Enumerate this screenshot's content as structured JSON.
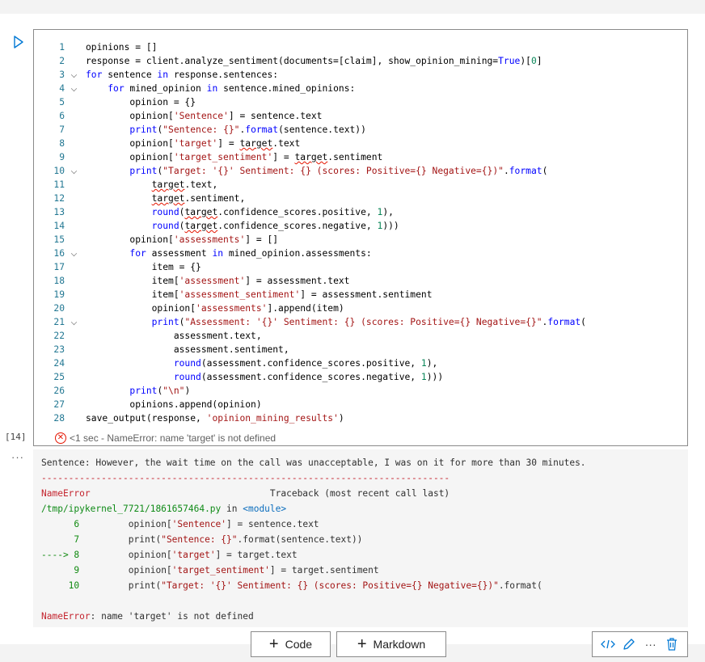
{
  "execution_count": "[14]",
  "status": {
    "text": "<1 sec - NameError: name 'target' is not defined"
  },
  "output_dots": "···",
  "code_lines": [
    {
      "n": "1",
      "fold": false,
      "html": "opinions = []"
    },
    {
      "n": "2",
      "fold": false,
      "html": "response = client.analyze_sentiment(documents=[claim], show_opinion_mining=<span class='k'>True</span>)[<span class='n'>0</span>]"
    },
    {
      "n": "3",
      "fold": true,
      "html": "<span class='k'>for</span> sentence <span class='k'>in</span> response.sentences:"
    },
    {
      "n": "4",
      "fold": true,
      "html": "    <span class='k'>for</span> mined_opinion <span class='k'>in</span> sentence.mined_opinions:"
    },
    {
      "n": "5",
      "fold": false,
      "html": "        opinion = {}"
    },
    {
      "n": "6",
      "fold": false,
      "html": "        opinion[<span class='s'>'Sentence'</span>] = sentence.text"
    },
    {
      "n": "7",
      "fold": false,
      "html": "        <span class='k'>print</span>(<span class='s'>\"Sentence: {}\"</span>.<span class='k'>format</span>(sentence.text))"
    },
    {
      "n": "8",
      "fold": false,
      "html": "        opinion[<span class='s'>'target'</span>] = <span class='err-u'>target</span>.text"
    },
    {
      "n": "9",
      "fold": false,
      "html": "        opinion[<span class='s'>'target_sentiment'</span>] = <span class='err-u'>target</span>.sentiment"
    },
    {
      "n": "10",
      "fold": true,
      "html": "        <span class='k'>print</span>(<span class='s'>\"Target: '{}' Sentiment: {} (scores: Positive={} Negative={})\"</span>.<span class='k'>format</span>("
    },
    {
      "n": "11",
      "fold": false,
      "html": "            <span class='err-u'>target</span>.text,"
    },
    {
      "n": "12",
      "fold": false,
      "html": "            <span class='err-u'>target</span>.sentiment,"
    },
    {
      "n": "13",
      "fold": false,
      "html": "            <span class='k'>round</span>(<span class='err-u'>target</span>.confidence_scores.positive, <span class='n'>1</span>),"
    },
    {
      "n": "14",
      "fold": false,
      "html": "            <span class='k'>round</span>(<span class='err-u'>target</span>.confidence_scores.negative, <span class='n'>1</span>)))"
    },
    {
      "n": "15",
      "fold": false,
      "html": "        opinion[<span class='s'>'assessments'</span>] = []"
    },
    {
      "n": "16",
      "fold": true,
      "html": "        <span class='k'>for</span> assessment <span class='k'>in</span> mined_opinion.assessments:"
    },
    {
      "n": "17",
      "fold": false,
      "html": "            item = {}"
    },
    {
      "n": "18",
      "fold": false,
      "html": "            item[<span class='s'>'assessment'</span>] = assessment.text"
    },
    {
      "n": "19",
      "fold": false,
      "html": "            item[<span class='s'>'assessment_sentiment'</span>] = assessment.sentiment"
    },
    {
      "n": "20",
      "fold": false,
      "html": "            opinion[<span class='s'>'assessments'</span>].append(item)"
    },
    {
      "n": "21",
      "fold": true,
      "html": "            <span class='k'>print</span>(<span class='s'>\"Assessment: '{}' Sentiment: {} (scores: Positive={} Negative={}\"</span>.<span class='k'>format</span>("
    },
    {
      "n": "22",
      "fold": false,
      "html": "                assessment.text,"
    },
    {
      "n": "23",
      "fold": false,
      "html": "                assessment.sentiment,"
    },
    {
      "n": "24",
      "fold": false,
      "html": "                <span class='k'>round</span>(assessment.confidence_scores.positive, <span class='n'>1</span>),"
    },
    {
      "n": "25",
      "fold": false,
      "html": "                <span class='k'>round</span>(assessment.confidence_scores.negative, <span class='n'>1</span>)))"
    },
    {
      "n": "26",
      "fold": false,
      "html": "        <span class='k'>print</span>(<span class='s'>\"\\n\"</span>)"
    },
    {
      "n": "27",
      "fold": false,
      "html": "        opinions.append(opinion)"
    },
    {
      "n": "28",
      "fold": false,
      "html": "save_output(response, <span class='s'>'opinion_mining_results'</span>)"
    }
  ],
  "output_lines": [
    {
      "html": "Sentence: However, the wait time on the call was unacceptable, I was on it for more than 30 minutes."
    },
    {
      "html": "<span class='red'>---------------------------------------------------------------------------</span>"
    },
    {
      "html": "<span class='red'>NameError</span>                                 Traceback (most recent call last)"
    },
    {
      "html": "<span class='green'>/tmp/ipykernel_7721/1861657464.py</span> in <span class='cyan'>&lt;module&gt;</span>"
    },
    {
      "html": "<span class='gb'>      6</span>         opinion[<span class='d-s'>'Sentence'</span>] = sentence.text"
    },
    {
      "html": "<span class='gb'>      7</span>         print(<span class='d-s'>\"Sentence: {}\"</span>.format(sentence.text))"
    },
    {
      "html": "<span class='gb'>----&gt; 8</span>         opinion[<span class='d-s'>'target'</span>] = target.text"
    },
    {
      "html": "<span class='gb'>      9</span>         opinion[<span class='d-s'>'target_sentiment'</span>] = target.sentiment"
    },
    {
      "html": "<span class='gb'>     10</span>         print(<span class='d-s'>\"Target: '{}' Sentiment: {} (scores: Positive={} Negative={})\"</span>.format("
    },
    {
      "html": ""
    },
    {
      "html": "<span class='red'>NameError</span>: name 'target' is not defined"
    }
  ],
  "buttons": {
    "code": "Code",
    "markdown": "Markdown"
  },
  "icons": {
    "run": "play-icon",
    "status_error": "error-circle-icon",
    "toolbar": [
      "code-brackets-icon",
      "edit-pencil-icon",
      "more-icon",
      "trash-icon"
    ]
  },
  "colors": {
    "accent": "#0078d4",
    "error": "#e51400"
  }
}
